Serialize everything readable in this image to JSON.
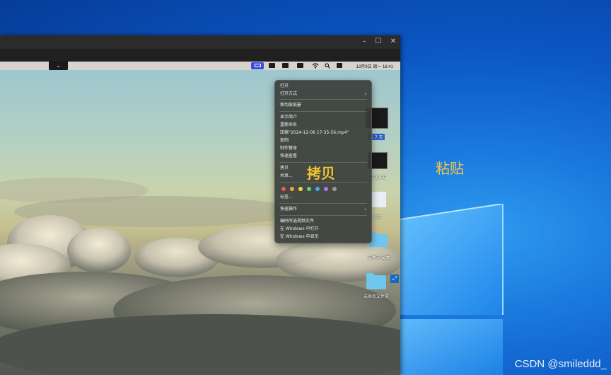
{
  "overlays": {
    "copy_annotation": "拷贝",
    "paste_annotation": "粘贴",
    "watermark": "CSDN @smileddd_"
  },
  "vm_window": {
    "controls": {
      "minimize": "–",
      "maximize": "☐",
      "close": "✕"
    },
    "dock_toggle": "⌄"
  },
  "mac_menubar": {
    "clock": "12月9日 周一  16:41",
    "status_icons": [
      "screen-sharing-icon",
      "image-icon",
      "apps-icon",
      "display-icon",
      "wifi-icon",
      "search-icon",
      "control-center-icon"
    ]
  },
  "desktop_icons": [
    {
      "label": "去 7 天",
      "kind": "video"
    },
    {
      "label": "去 30 天",
      "kind": "video"
    },
    {
      "label": "十月",
      "kind": "document"
    },
    {
      "label": "文件夹 副本",
      "kind": "folder"
    },
    {
      "label": "未命名文件夹",
      "kind": "folder"
    }
  ],
  "context_menu": {
    "items": {
      "open": "打开",
      "open_with": "打开方式",
      "move_to_trash": "移到废纸篓",
      "get_info": "显示简介",
      "rename": "重新命名",
      "compress": "压缩“2024-12-06 17-35-56.mp4”",
      "duplicate": "复制",
      "make_alias": "制作替身",
      "quick_look": "快速查看",
      "copy": "拷贝",
      "share": "共享...",
      "tags": "标签...",
      "quick_actions": "快速操作",
      "encode_video": "编码所选视频文件",
      "open_in_windows": "在 Windows 中打开",
      "show_in_windows": "在 Windows 中显示"
    },
    "tag_colors": [
      "#f05a5a",
      "#f5a04a",
      "#f2d64a",
      "#5fd46a",
      "#4aa8f0",
      "#b873e6",
      "#9a9a9a"
    ]
  },
  "colors": {
    "windows_logo": "#3fa6ff",
    "menu_bg": "#3a3e3a",
    "annotation": "#f1c232"
  }
}
